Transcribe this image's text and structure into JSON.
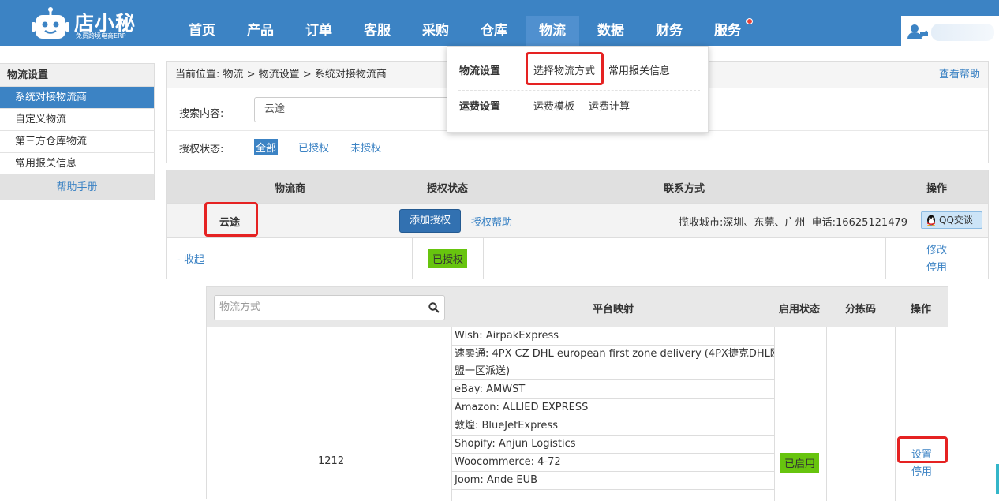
{
  "brand": {
    "name": "店小秘",
    "tagline": "免费跨境电商ERP"
  },
  "nav": [
    "首页",
    "产品",
    "订单",
    "客服",
    "采购",
    "仓库",
    "物流",
    "数据",
    "财务",
    "服务"
  ],
  "nav_active": "物流",
  "sidebar": {
    "title": "物流设置",
    "items": [
      "系统对接物流商",
      "自定义物流",
      "第三方仓库物流",
      "常用报关信息"
    ],
    "help": "帮助手册"
  },
  "breadcrumb": "当前位置:  物流 > 物流设置 > 系统对接物流商",
  "help_link": "查看帮助",
  "search": {
    "label": "搜索内容:",
    "value": "云途"
  },
  "auth": {
    "label": "授权状态:",
    "options": [
      "全部",
      "已授权",
      "未授权"
    ]
  },
  "dropdown": {
    "row1": {
      "head": "物流设置",
      "links": [
        "选择物流方式",
        "常用报关信息"
      ]
    },
    "row2": {
      "head": "运费设置",
      "links": [
        "运费模板",
        "运费计算"
      ]
    }
  },
  "provider_table": {
    "headers": [
      "物流商",
      "授权状态",
      "联系方式",
      "操作"
    ],
    "provider": "云途",
    "add_auth": "添加授权",
    "auth_help": "授权帮助",
    "contact": "揽收城市:深圳、东莞、广州  电话:16625121479",
    "qq": "QQ交谈",
    "collapse": "- 收起",
    "status": "已授权",
    "ops": [
      "修改",
      "停用"
    ]
  },
  "method_table": {
    "search_placeholder": "物流方式",
    "headers": [
      "平台映射",
      "启用状态",
      "分拣码",
      "操作"
    ],
    "code": "1212",
    "mappings": [
      "Wish:  AirpakExpress",
      "速卖通:  4PX CZ DHL european first zone delivery (4PX捷克DHL欧",
      "盟一区派送)",
      "eBay:  AMWST",
      "Amazon:  ALLIED EXPRESS",
      "敦煌:  BlueJetExpress",
      "Shopify:  Anjun Logistics",
      "Woocommerce:  4-72",
      "Joom:  Ande EUB"
    ],
    "status": "已启用",
    "ops": [
      "设置",
      "停用"
    ]
  }
}
